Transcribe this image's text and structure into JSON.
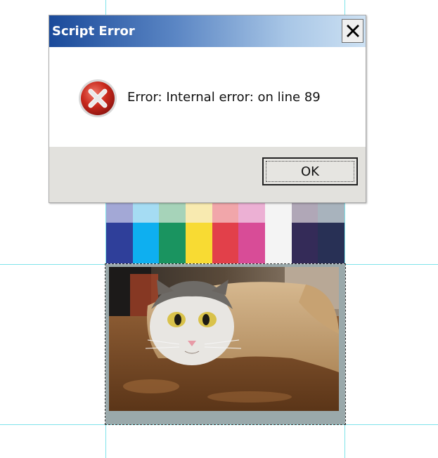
{
  "dialog": {
    "title": "Script Error",
    "close_glyph": "✕",
    "message": "Error: Internal error: on line 89",
    "icon": "error-icon",
    "ok_label": "OK",
    "title_color_start": "#1a4a9a",
    "title_color_end": "#cde1f3"
  },
  "palette": {
    "swatches": [
      {
        "light": "#a3a8d6",
        "dark": "#2f3f9a"
      },
      {
        "light": "#a5dcf3",
        "dark": "#0eaff0"
      },
      {
        "light": "#a6d3b9",
        "dark": "#1a9460"
      },
      {
        "light": "#f8eab0",
        "dark": "#f8db33"
      },
      {
        "light": "#f1a6aa",
        "dark": "#e2404a"
      },
      {
        "light": "#ecb0d4",
        "dark": "#d84c97"
      },
      {
        "light": "#f4f4f4",
        "dark": "#f4f4f4"
      },
      {
        "light": "#b0a7b7",
        "dark": "#342b58"
      },
      {
        "light": "#a8b3bd",
        "dark": "#283055"
      }
    ]
  },
  "image": {
    "subject": "cat in paper roll"
  }
}
